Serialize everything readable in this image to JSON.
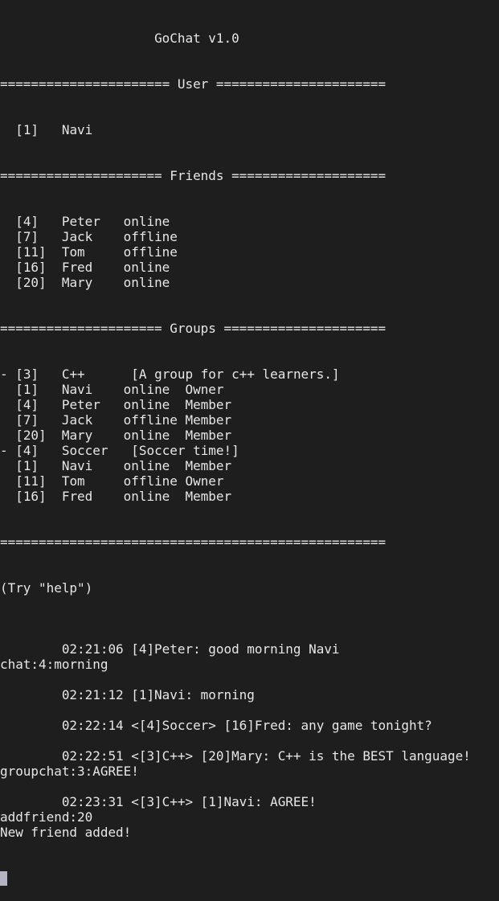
{
  "app": {
    "title": "GoChat v1.0"
  },
  "separators": {
    "user": "====================== User ======================",
    "friends": "===================== Friends ====================",
    "groups": "===================== Groups =====================",
    "end": "=================================================="
  },
  "user": {
    "id": "[1]",
    "name": "Navi"
  },
  "friends": [
    {
      "id": "[4]",
      "name": "Peter",
      "status": "online"
    },
    {
      "id": "[7]",
      "name": "Jack",
      "status": "offline"
    },
    {
      "id": "[11]",
      "name": "Tom",
      "status": "offline"
    },
    {
      "id": "[16]",
      "name": "Fred",
      "status": "online"
    },
    {
      "id": "[20]",
      "name": "Mary",
      "status": "online"
    }
  ],
  "groups": [
    {
      "id": "[3]",
      "name": "C++",
      "description": "[A group for c++ learners.]",
      "members": [
        {
          "id": "[1]",
          "name": "Navi",
          "status": "online",
          "role": "Owner"
        },
        {
          "id": "[4]",
          "name": "Peter",
          "status": "online",
          "role": "Member"
        },
        {
          "id": "[7]",
          "name": "Jack",
          "status": "offline",
          "role": "Member"
        },
        {
          "id": "[20]",
          "name": "Mary",
          "status": "online",
          "role": "Member"
        }
      ]
    },
    {
      "id": "[4]",
      "name": "Soccer",
      "description": "[Soccer time!]",
      "members": [
        {
          "id": "[1]",
          "name": "Navi",
          "status": "online",
          "role": "Member"
        },
        {
          "id": "[11]",
          "name": "Tom",
          "status": "offline",
          "role": "Owner"
        },
        {
          "id": "[16]",
          "name": "Fred",
          "status": "online",
          "role": "Member"
        }
      ]
    }
  ],
  "hint": "(Try \"help\")",
  "transcript": [
    {
      "type": "blank",
      "text": ""
    },
    {
      "type": "message",
      "text": "        02:21:06 [4]Peter: good morning Navi"
    },
    {
      "type": "command",
      "text": "chat:4:morning"
    },
    {
      "type": "blank",
      "text": ""
    },
    {
      "type": "message",
      "text": "        02:21:12 [1]Navi: morning"
    },
    {
      "type": "blank",
      "text": ""
    },
    {
      "type": "message",
      "text": "        02:22:14 <[4]Soccer> [16]Fred: any game tonight?"
    },
    {
      "type": "blank",
      "text": ""
    },
    {
      "type": "message",
      "text": "        02:22:51 <[3]C++> [20]Mary: C++ is the BEST language!"
    },
    {
      "type": "command",
      "text": "groupchat:3:AGREE!"
    },
    {
      "type": "blank",
      "text": ""
    },
    {
      "type": "message",
      "text": "        02:23:31 <[3]C++> [1]Navi: AGREE!"
    },
    {
      "type": "command",
      "text": "addfriend:20"
    },
    {
      "type": "output",
      "text": "New friend added!"
    }
  ],
  "input": {
    "value": ""
  },
  "colors": {
    "background": "#1e1e1e",
    "foreground": "#e6e6e6",
    "cursor": "#b4b4c4"
  }
}
